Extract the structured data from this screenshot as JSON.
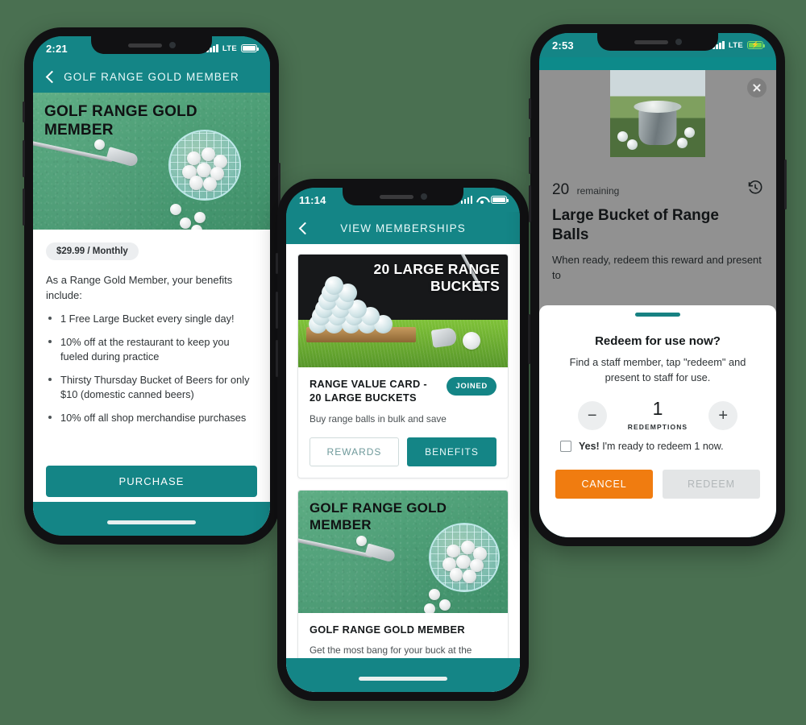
{
  "theme": {
    "page_background": "#4a7051",
    "teal": "#148586",
    "orange": "#f07c10",
    "turf_green": "#4e9f77"
  },
  "phone1": {
    "status": {
      "time": "2:21",
      "network": "LTE",
      "signal_icon": "signal-bars-icon",
      "battery_icon": "battery-icon"
    },
    "nav": {
      "back_icon": "chevron-left-icon",
      "title": "GOLF RANGE GOLD MEMBER"
    },
    "hero": {
      "title": "GOLF RANGE GOLD MEMBER",
      "image_alt": "golf-turf-basket-balls-image"
    },
    "price_pill": "$29.99 / Monthly",
    "intro": "As a Range Gold Member, your benefits include:",
    "benefits": [
      "1 Free Large Bucket every single day!",
      "10% off at the restaurant to keep you fueled during practice",
      "Thirsty Thursday Bucket of Beers for only $10 (domestic canned beers)",
      "10% off all shop merchandise purchases"
    ],
    "purchase_button": "PURCHASE"
  },
  "phone2": {
    "status": {
      "time": "11:14",
      "signal_icon": "signal-bars-icon",
      "wifi_icon": "wifi-icon",
      "battery_icon": "battery-icon"
    },
    "nav": {
      "back_icon": "chevron-left-icon",
      "title": "VIEW MEMBERSHIPS"
    },
    "cards": [
      {
        "image_title": "20 LARGE RANGE BUCKETS",
        "image_alt": "range-balls-pyramid-image",
        "title": "RANGE VALUE CARD - 20 LARGE BUCKETS",
        "badge": "JOINED",
        "subtitle": "Buy range balls in bulk and save",
        "action_secondary": "REWARDS",
        "action_primary": "BENEFITS"
      },
      {
        "image_title": "GOLF RANGE GOLD MEMBER",
        "image_alt": "golf-turf-basket-balls-image",
        "title": "GOLF RANGE GOLD MEMBER",
        "subtitle": "Get the most bang for your buck at the range as a gold member"
      }
    ]
  },
  "phone3": {
    "status": {
      "time": "2:53",
      "network": "LTE",
      "signal_icon": "signal-bars-icon",
      "battery_icon": "battery-charging-icon"
    },
    "close_icon": "close-icon",
    "reward_image_alt": "bucket-of-range-balls-photo",
    "remaining_count": "20",
    "remaining_label": "remaining",
    "history_icon": "history-clock-icon",
    "reward_title": "Large Bucket of Range Balls",
    "reward_desc": "When ready, redeem this reward and present to",
    "sheet": {
      "heading": "Redeem for use now?",
      "body": "Find a staff member, tap \"redeem\" and present to staff for use.",
      "minus_label": "−",
      "plus_label": "+",
      "quantity": "1",
      "quantity_label": "REDEMPTIONS",
      "confirm_prefix": "Yes!",
      "confirm_text": " I'm ready to redeem 1 now.",
      "cancel_button": "CANCEL",
      "redeem_button": "REDEEM"
    }
  }
}
